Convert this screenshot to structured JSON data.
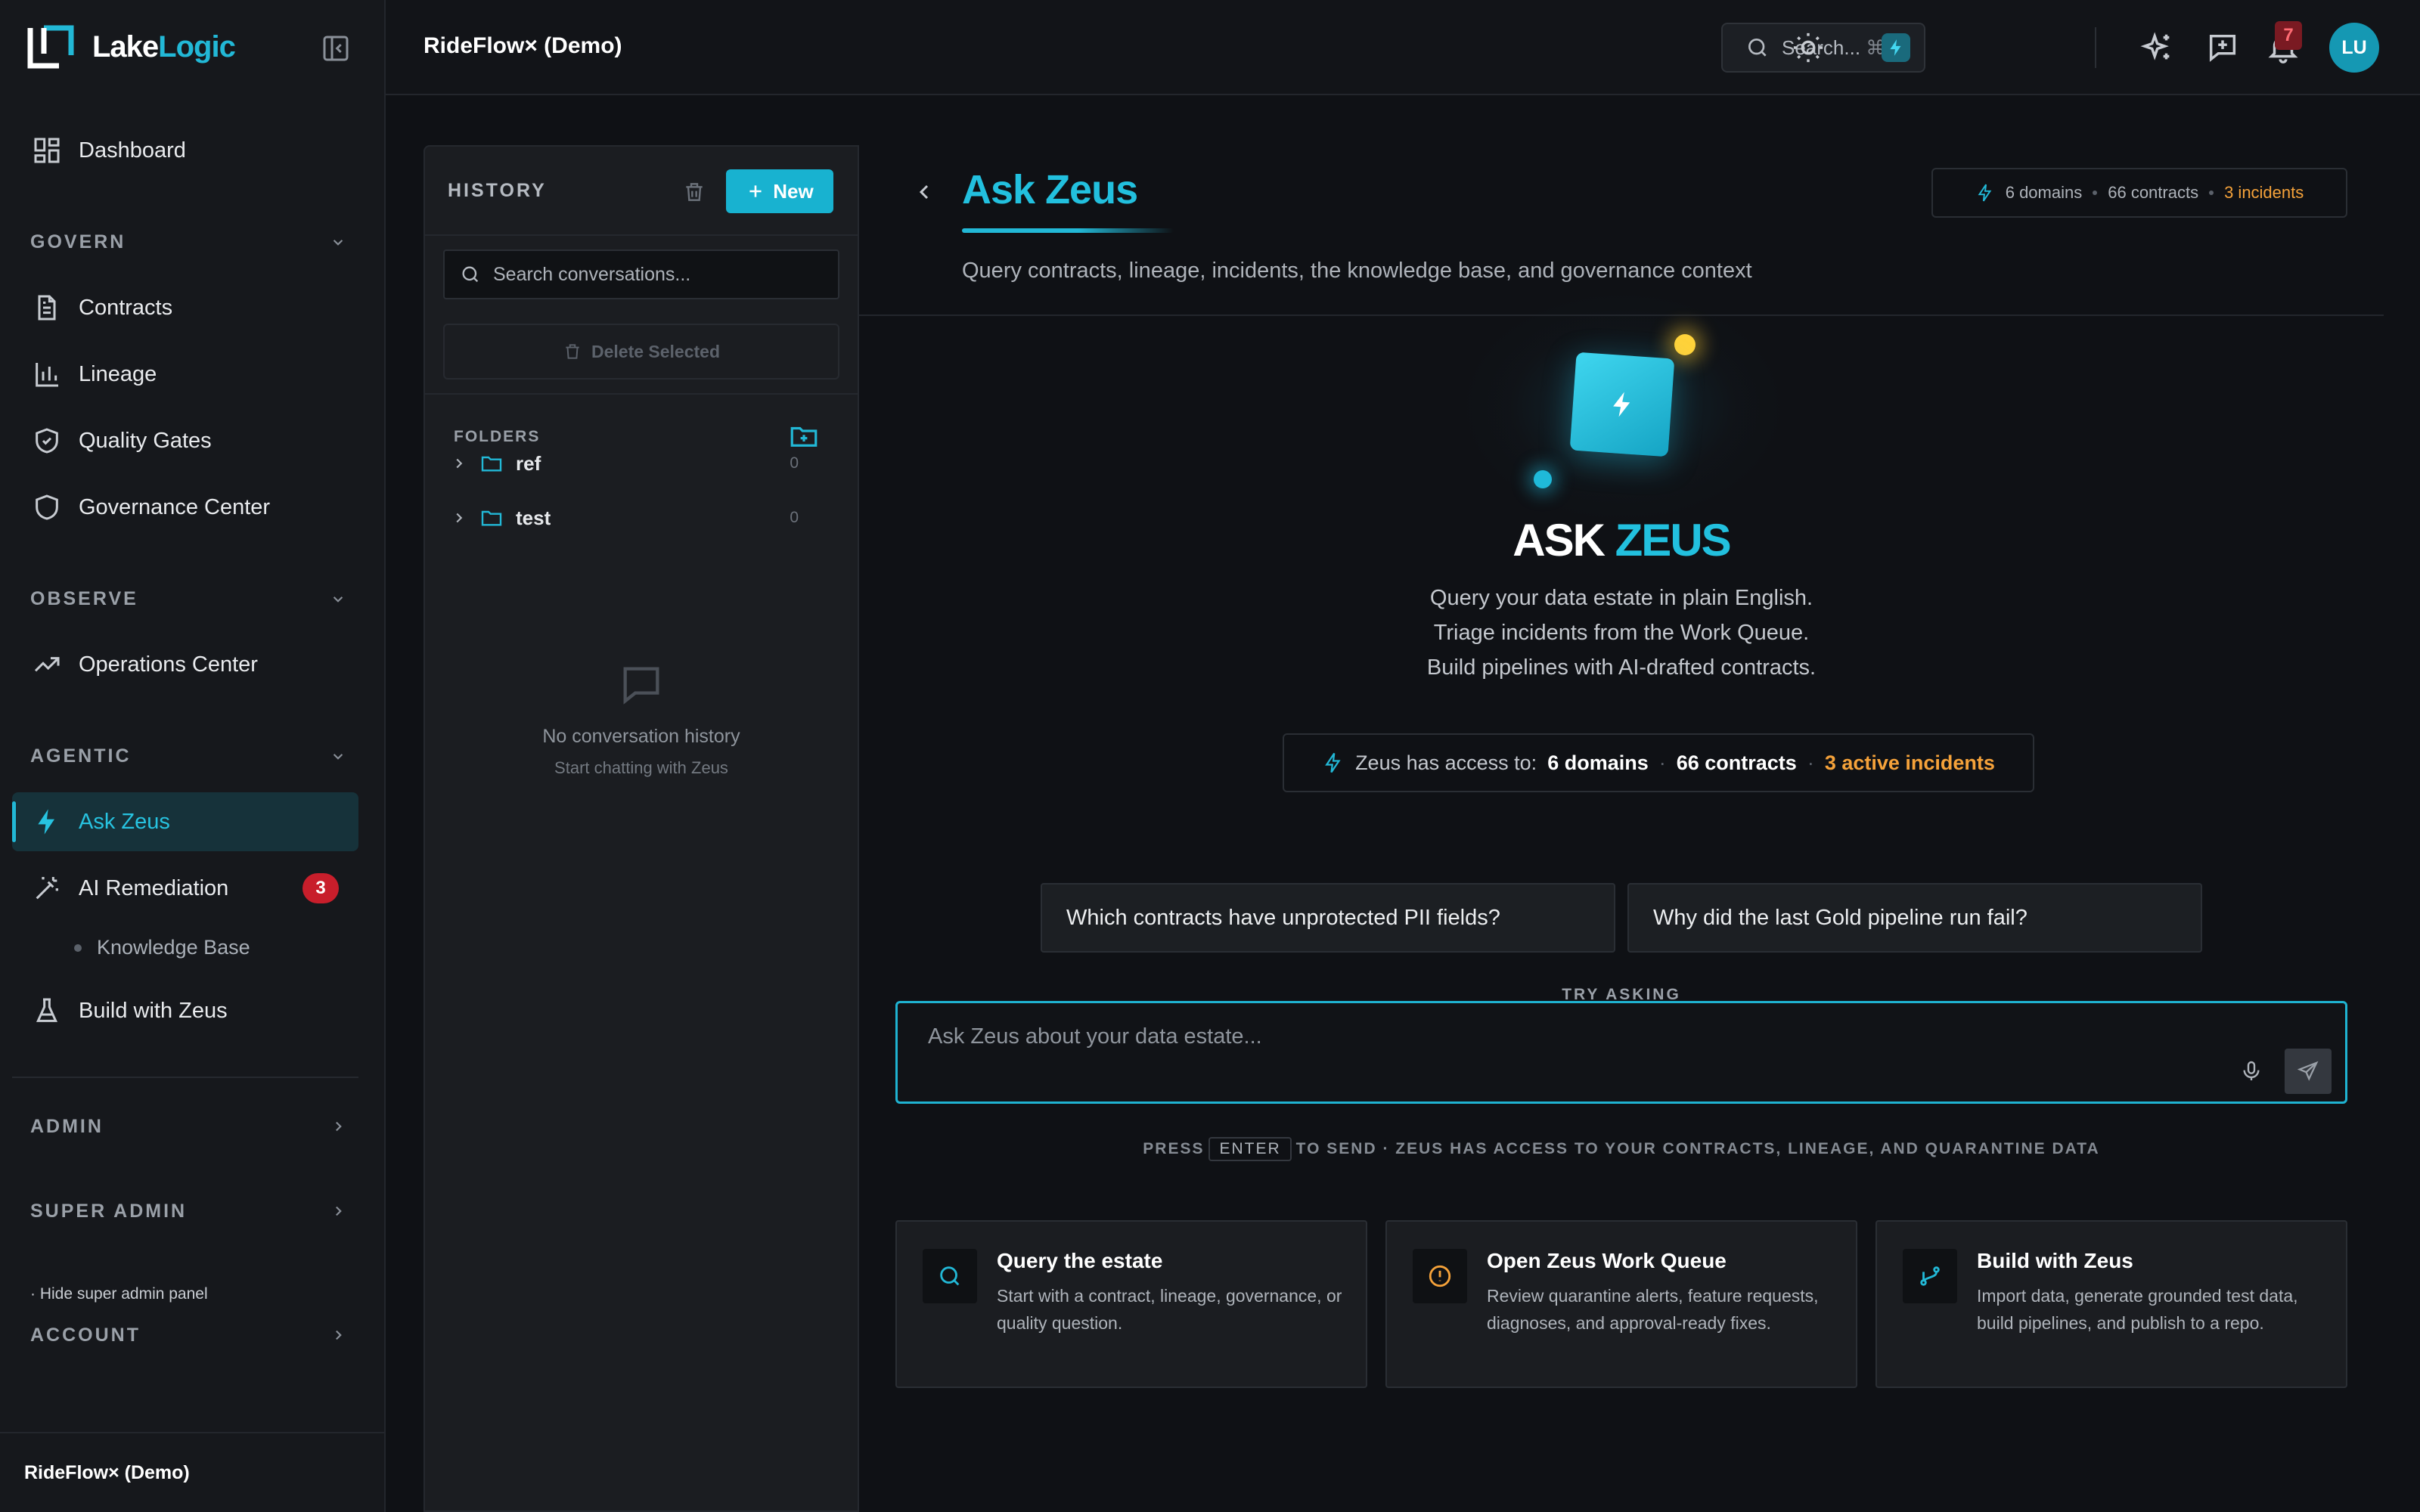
{
  "brand": {
    "name_part1": "Lake",
    "name_part2": "Logic",
    "accent": "#22b8d6"
  },
  "sidebar": {
    "dashboard": "Dashboard",
    "sections": {
      "govern": "GOVERN",
      "observe": "OBSERVE",
      "agentic": "AGENTIC",
      "admin": "ADMIN",
      "super_admin": "SUPER ADMIN",
      "account": "ACCOUNT"
    },
    "items": {
      "contracts": "Contracts",
      "lineage": "Lineage",
      "quality_gates": "Quality Gates",
      "governance_center": "Governance Center",
      "operations_center": "Operations Center",
      "ask_zeus": "Ask Zeus",
      "ai_remediation": "AI Remediation",
      "ai_remediation_badge": "3",
      "knowledge_base": "Knowledge Base",
      "build_with_zeus": "Build with Zeus"
    },
    "hide_super_admin": "· Hide super admin panel",
    "footer_workspace": "RideFlow× (Demo)"
  },
  "topbar": {
    "workspace_title": "RideFlow× (Demo)",
    "search_label": "Search...",
    "search_shortcut": "⌘K",
    "notifications_count": "7",
    "avatar_initials": "LU"
  },
  "history": {
    "title": "HISTORY",
    "new_label": "New",
    "search_placeholder": "Search conversations...",
    "delete_selected": "Delete Selected",
    "folders_label": "FOLDERS",
    "folders": [
      {
        "name": "ref",
        "count": "0"
      },
      {
        "name": "test",
        "count": "0"
      }
    ],
    "empty_title": "No conversation history",
    "empty_sub": "Start chatting with Zeus"
  },
  "main": {
    "title": "Ask Zeus",
    "subtitle": "Query contracts, lineage, incidents, the knowledge base, and governance context",
    "stats": {
      "domains": "6 domains",
      "contracts": "66 contracts",
      "incidents": "3 incidents"
    },
    "hero": {
      "title_part1": "ASK ",
      "title_part2": "ZEUS",
      "lines": [
        "Query your data estate in plain English.",
        "Triage incidents from the Work Queue.",
        "Build pipelines with AI-drafted contracts."
      ]
    },
    "access": {
      "prefix": "Zeus has access to:",
      "domains": "6 domains",
      "contracts": "66 contracts",
      "incidents": "3 active incidents"
    },
    "try_asking": "TRY ASKING",
    "suggestions": [
      "Which contracts have unprotected PII fields?",
      "Why did the last Gold pipeline run fail?"
    ],
    "input_placeholder": "Ask Zeus about your data estate...",
    "hint": {
      "press": "PRESS",
      "key": "ENTER",
      "rest": "TO SEND · ZEUS HAS ACCESS TO YOUR CONTRACTS, LINEAGE, AND QUARANTINE DATA"
    },
    "cards": [
      {
        "title": "Query the estate",
        "desc": "Start with a contract, lineage, governance, or quality question.",
        "icon": "search-icon",
        "color": "#22b8d6"
      },
      {
        "title": "Open Zeus Work Queue",
        "desc": "Review quarantine alerts, feature requests, diagnoses, and approval-ready fixes.",
        "icon": "alert-circle-icon",
        "color": "#f5a23a"
      },
      {
        "title": "Build with Zeus",
        "desc": "Import data, generate grounded test data, build pipelines, and publish to a repo.",
        "icon": "git-branch-icon",
        "color": "#22b8d6"
      }
    ]
  }
}
